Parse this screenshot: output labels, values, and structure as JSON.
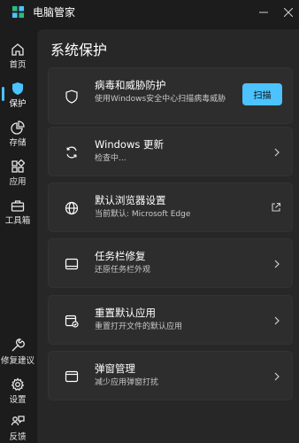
{
  "app": {
    "title": "电脑管家",
    "colors": {
      "accent": "#4cc2ff",
      "background": "#1c1c1c",
      "panel": "#272727",
      "card": "#2d2d2d"
    }
  },
  "nav": {
    "items": [
      {
        "label": "首页",
        "icon": "home-icon",
        "active": false
      },
      {
        "label": "保护",
        "icon": "shield-icon",
        "active": true
      },
      {
        "label": "存储",
        "icon": "pie-chart-icon",
        "active": false
      },
      {
        "label": "应用",
        "icon": "apps-icon",
        "active": false
      },
      {
        "label": "工具箱",
        "icon": "toolbox-icon",
        "active": false
      }
    ],
    "bottom": [
      {
        "label": "修复建议",
        "icon": "wrench-icon"
      },
      {
        "label": "设置",
        "icon": "gear-icon"
      },
      {
        "label": "反馈",
        "icon": "feedback-icon"
      }
    ]
  },
  "main": {
    "title": "系统保护",
    "cards": [
      {
        "title": "病毒和威胁防护",
        "subtitle": "使用Windows安全中心扫描病毒威胁",
        "icon": "shield-outline-icon",
        "action": "扫描"
      },
      {
        "title": "Windows 更新",
        "subtitle": "检查中...",
        "icon": "refresh-icon"
      },
      {
        "title": "默认浏览器设置",
        "subtitle": "当前默认: Microsoft Edge",
        "icon": "globe-icon"
      },
      {
        "title": "任务栏修复",
        "subtitle": "还原任务栏外观",
        "icon": "taskbar-icon"
      },
      {
        "title": "重置默认应用",
        "subtitle": "重置打开文件的默认应用",
        "icon": "reset-app-icon"
      },
      {
        "title": "弹窗管理",
        "subtitle": "减少应用弹窗打扰",
        "icon": "window-icon"
      }
    ]
  }
}
